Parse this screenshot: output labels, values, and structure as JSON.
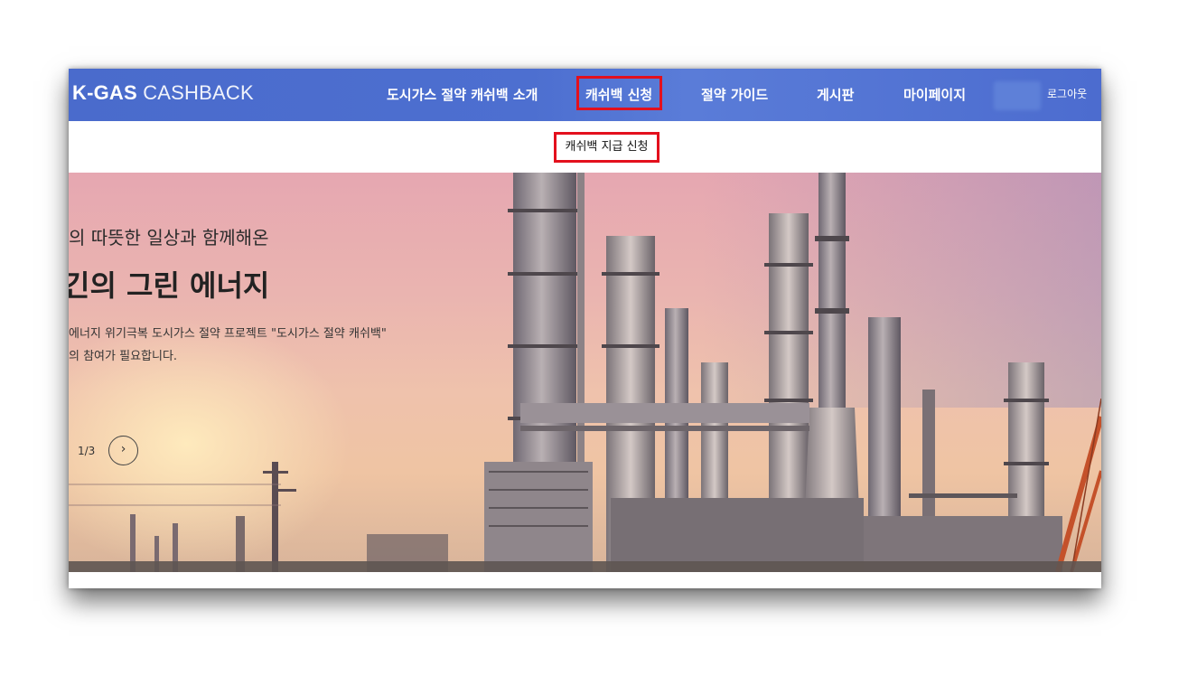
{
  "header": {
    "logo_bold": "K-GAS",
    "logo_light": " CASHBACK",
    "nav": [
      {
        "label": "도시가스 절약 캐쉬백 소개"
      },
      {
        "label": "캐쉬백 신청"
      },
      {
        "label": "절약 가이드"
      },
      {
        "label": "게시판"
      },
      {
        "label": "마이페이지"
      }
    ],
    "logout_label": "로그아웃"
  },
  "submenu": {
    "item_label": "캐쉬백 지급 신청"
  },
  "hero": {
    "subtitle": "의 따뜻한 일상과 함께해온",
    "title": "긴의 그린 에너지",
    "desc_line1": "에너지 위기극복 도시가스 절약 프로젝트 \"도시가스 절약 캐쉬백\"",
    "desc_line2": "의 참여가 필요합니다.",
    "pager": "1/3",
    "next_icon": "›"
  },
  "colors": {
    "header_bg": "#4a6bcc",
    "highlight": "#e3101d"
  }
}
